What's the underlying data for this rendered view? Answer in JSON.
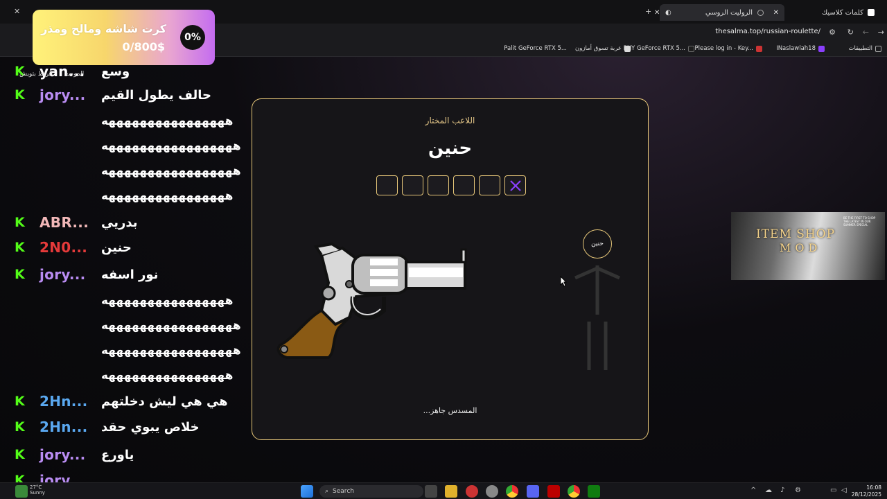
{
  "browser": {
    "tabs": [
      {
        "label": "كلمات كلاسيك"
      },
      {
        "label": "الروليت الروسي"
      }
    ],
    "url": "thesalma.top/russian-roulette/",
    "bookmarks": [
      {
        "label": "التطبيقات"
      },
      {
        "label": "INaslawlah18"
      },
      {
        "label": "Please log in - Key..."
      },
      {
        "label": "PNY GeForce RTX 5..."
      },
      {
        "label": "عربة تسوق أمازون"
      },
      {
        "label": "Palit GeForce RTX 5..."
      }
    ]
  },
  "goal": {
    "title": "كرت شاشه ومالح ومذر",
    "amount": "0/800$",
    "percent": "0%"
  },
  "chat": {
    "mini_labels": [
      "الموضع",
      "الربط بتويش"
    ],
    "messages": [
      {
        "user": "yan...",
        "text": "وسع",
        "color": "#ffffff"
      },
      {
        "user": "jory...",
        "text": "حالف يطول القيم",
        "color": "#b98cf2"
      },
      {
        "user": "",
        "text": "ههههههههههههههههه",
        "color": "#ffffff"
      },
      {
        "user": "",
        "text": "هههههههههههههههههه",
        "color": "#ffffff"
      },
      {
        "user": "",
        "text": "هههههههههههههههههه",
        "color": "#ffffff"
      },
      {
        "user": "",
        "text": "ههههههههههههههههه",
        "color": "#ffffff"
      },
      {
        "user": "ABR...",
        "text": "بدريي",
        "color": "#f2b8b8"
      },
      {
        "user": "2N0...",
        "text": "حنين",
        "color": "#e53a3a"
      },
      {
        "user": "jory...",
        "text": "نور اسفه",
        "color": "#b98cf2"
      },
      {
        "user": "",
        "text": "ههههههههههههههههه",
        "color": "#ffffff"
      },
      {
        "user": "",
        "text": "هههههههههههههههههه",
        "color": "#ffffff"
      },
      {
        "user": "",
        "text": "هههههههههههههههههه",
        "color": "#ffffff"
      },
      {
        "user": "",
        "text": "ههههههههههههههههه",
        "color": "#ffffff"
      },
      {
        "user": "2Hn...",
        "text": "هي هي ليش دخلتهم",
        "color": "#5aa8f0"
      },
      {
        "user": "2Hn...",
        "text": "خلاص يبوي حقد",
        "color": "#5aa8f0"
      },
      {
        "user": "jory...",
        "text": "ياورع",
        "color": "#b98cf2"
      },
      {
        "user": "jory...",
        "text": "",
        "color": "#b98cf2"
      }
    ]
  },
  "game": {
    "label": "اللاعب المختار",
    "player_name": "حنين",
    "chambers": [
      "empty",
      "empty",
      "empty",
      "empty",
      "empty",
      "fired"
    ],
    "status": "المسدس جاهز...",
    "figure_label": "حنين"
  },
  "ad": {
    "title": "ITEM SHOP",
    "subtitle": "MOD",
    "tiny": "BE THE FIRST TO SHOP THE LATEST IN OUR SUMMER SPECIAL"
  },
  "taskbar": {
    "search_label": "Search",
    "weather_temp": "27°C",
    "weather_desc": "Sunny",
    "time": "16:08",
    "date": "28/12/2025"
  },
  "colors": {
    "gold": "#e8c87a",
    "kick_green": "#53fc18",
    "accent_purple": "#8a3ffc"
  }
}
